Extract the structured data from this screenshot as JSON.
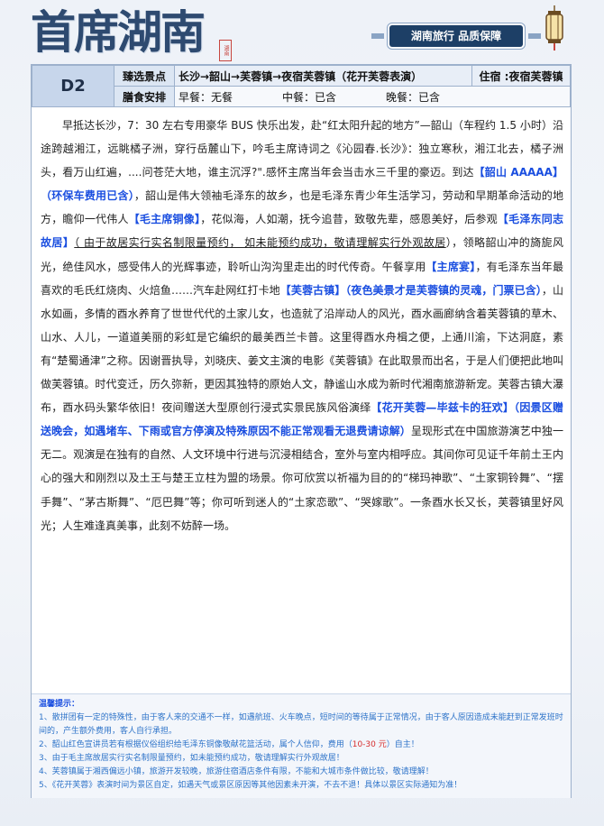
{
  "brand": {
    "title": "首席湖南",
    "slogan": "湖南旅行 品质保障",
    "seal": "湖南"
  },
  "header": {
    "day": "D2",
    "scenic_label": "臻选景点",
    "route": "长沙→韶山→芙蓉镇→夜宿芙蓉镇（花开芙蓉表演）",
    "stay": "住宿 :夜宿芙蓉镇",
    "meal_label": "膳食安排",
    "breakfast": "早餐：无餐",
    "lunch": "中餐：已含",
    "dinner": "晚餐：已含"
  },
  "content": {
    "s1": "早抵达长沙，7：30 左右专用豪华 BUS 快乐出发，赴“红太阳升起的地方”—韶山（车程约 1.5 小时）沿途跨越湘江，远眺橘子洲，穿行岳麓山下，吟毛主席诗词之《沁园春.长沙》：独立寒秋，湘江北去，橘子洲头，看万山红遍，....问苍茫大地，谁主沉浮?\".感怀主席当年会当击水三千里的豪迈。到达",
    "h1": "【韶山 AAAAA】（环保车费用已含）",
    "s2": "，韶山是伟大领袖毛泽东的故乡，也是毛泽东青少年生活学习，劳动和早期革命活动的地方，瞻仰一代伟人",
    "h2": "【毛主席铜像】",
    "s3": "，花似海，人如潮，抚今追昔，致敬先辈，感恩美好，后参观",
    "h3": "【毛泽东同志故居】",
    "u1": "（ 由于故居实行实名制限量预约， 如未能预约成功，敬请理解实行外观故居",
    "s4": "），领略韶山冲的旖旎风光，绝佳风水，感受伟人的光辉事迹，聆听山沟沟里走出的时代传奇。午餐享用",
    "h4": "【主席宴】",
    "s5": "，有毛泽东当年最喜欢的毛氏红烧肉、火焙鱼……汽车赴网红打卡地",
    "h5": "【芙蓉古镇】（夜色美景才是芙蓉镇的灵魂，门票已含）",
    "s6": "，山水如画，多情的酉水养育了世世代代的土家儿女，也造就了沿岸动人的风光，酉水画廊纳含着芙蓉镇的草木、山水、人儿，一道道美丽的彩虹是它编织的最美西兰卡普。这里得酉水舟楫之便，上通川渝，下达洞庭，素有“楚蜀通津”之称。因谢晋执导，刘晓庆、姜文主演的电影《芙蓉镇》在此取景而出名，于是人们便把此地叫做芙蓉镇。时代变迁，历久弥新，更因其独特的原始人文，静谧山水成为新时代湘南旅游新宠。芙蓉古镇大瀑布，酉水码头繁华依旧！夜间赠送大型原创行浸式实景民族风俗演绎",
    "h6": "【花开芙蓉—毕兹卡的狂欢】（因景区赠送晚会，如遇堵车、下雨或官方停演及特殊原因不能正常观看无退费请谅解）",
    "s7": "呈现形式在中国旅游演艺中独一无二。观演是在独有的自然、人文环境中行进与沉浸相结合，室外与室内相呼应。其间你可见证千年前土王内心的强大和刚烈以及土王与楚王立柱为盟的场景。你可欣赏以祈福为目的的“梯玛神歌”、“土家铜铃舞”、“摆手舞”、“茅古斯舞”、“厄巴舞”等；你可听到迷人的“土家恋歌”、“哭嫁歌”。一条酉水长又长，芙蓉镇里好风光；人生难逢真美事，此刻不妨醉一场。"
  },
  "tips": {
    "title": "温馨提示：",
    "t1": "1、散拼团有一定的特殊性，由于客人来的交通不一样，如遇航班、火车晚点，短时间的等待属于正常情况，由于客人原因造成未能赶到正常发班时间的，产生额外费用，客人自行承担。",
    "t2a": "2、韶山红色宣讲员若有根据仪俗组织给毛泽东铜像敬献花篮活动，属个人信仰，费用（",
    "t2b": "10-30 元",
    "t2c": "）自主！",
    "t3": "3、由于毛主席故居实行实名制限量预约，如未能预约成功，敬请理解实行外观故居！",
    "t4": "4、芙蓉镇属于湘西偏远小镇，旅游开发较晚，旅游住宿酒店条件有限，不能和大城市条件做比较，敬请理解！",
    "t5": "5、《花开芙蓉》表演时间为景区自定，如遇天气或景区原因等其他因素未开演，不去不退！具体以景区实际通知为准！"
  },
  "colors": {
    "accent": "#1a4ee0",
    "brand": "#2e4a70",
    "warn": "#d62d2d"
  }
}
